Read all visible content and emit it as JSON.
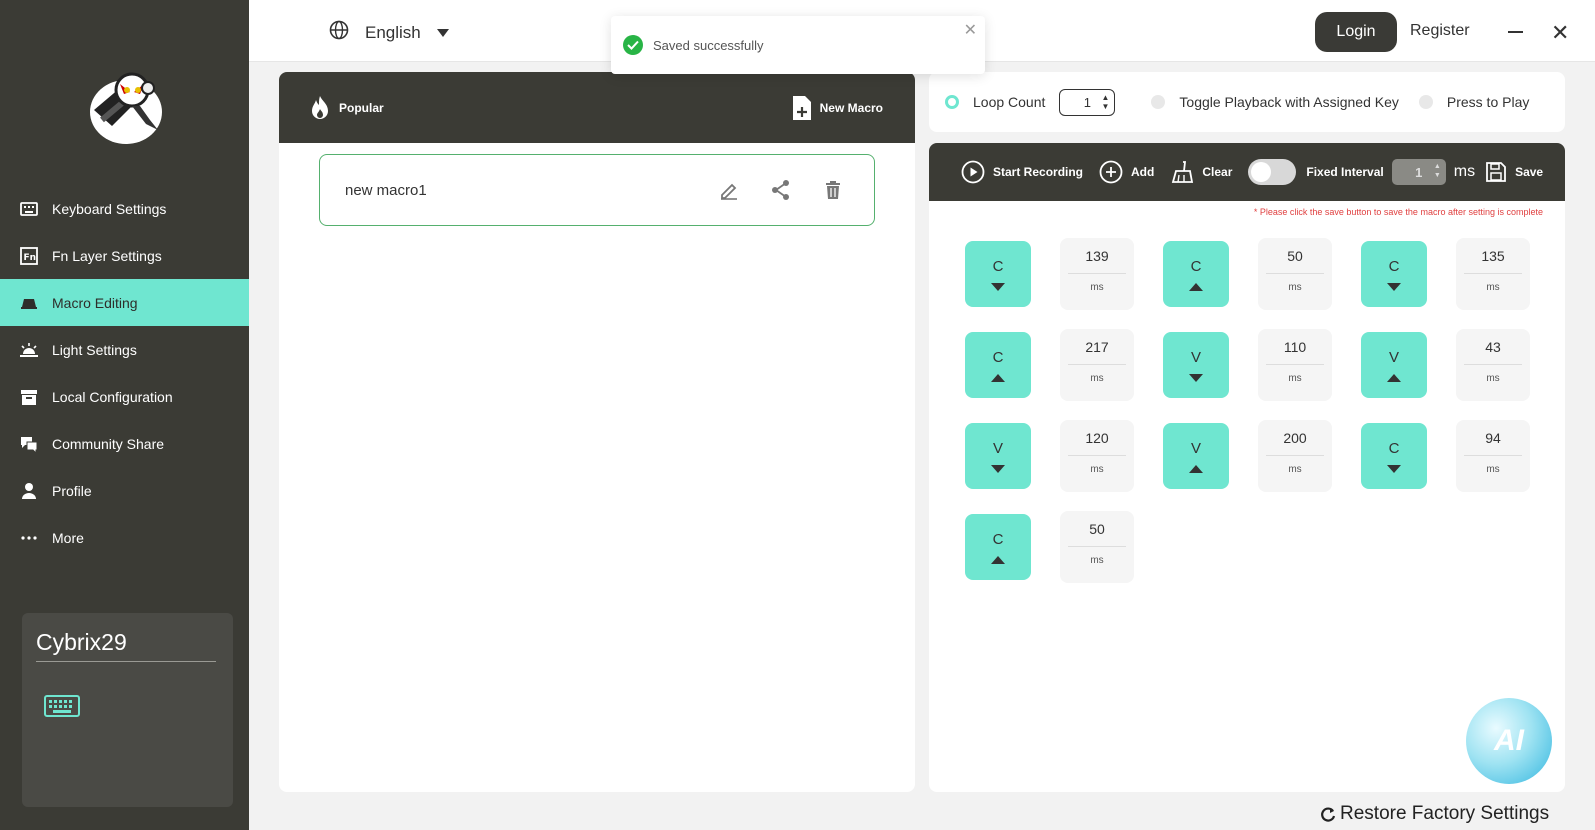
{
  "sidebar": {
    "nav": [
      {
        "label": "Keyboard Settings",
        "icon": "keyboard-icon"
      },
      {
        "label": "Fn Layer Settings",
        "icon": "fn-icon"
      },
      {
        "label": "Macro Editing",
        "icon": "macro-icon"
      },
      {
        "label": "Light Settings",
        "icon": "light-icon"
      },
      {
        "label": "Local Configuration",
        "icon": "archive-icon"
      },
      {
        "label": "Community Share",
        "icon": "chat-icon"
      },
      {
        "label": "Profile",
        "icon": "person-icon"
      },
      {
        "label": "More",
        "icon": "more-icon"
      }
    ],
    "active_index": 2,
    "device_name": "Cybrix29"
  },
  "topbar": {
    "language": "English",
    "login": "Login",
    "register": "Register"
  },
  "toast": {
    "message": "Saved successfully"
  },
  "macros": {
    "popular": "Popular",
    "new_macro": "New Macro",
    "items": [
      "new macro1"
    ]
  },
  "playback": {
    "loop_count_label": "Loop Count",
    "loop_count_value": "1",
    "toggle_label": "Toggle Playback with Assigned Key",
    "press_label": "Press to Play"
  },
  "toolbar": {
    "start_recording": "Start Recording",
    "add": "Add",
    "clear": "Clear",
    "fixed_interval": "Fixed Interval",
    "interval_value": "1",
    "ms": "ms",
    "save": "Save",
    "hint": "* Please click the save button to save the macro after setting is complete"
  },
  "events": [
    {
      "key": "C",
      "dir": "down",
      "delay": "139"
    },
    {
      "key": "C",
      "dir": "up",
      "delay": "50"
    },
    {
      "key": "C",
      "dir": "down",
      "delay": "135"
    },
    {
      "key": "C",
      "dir": "up",
      "delay": "217"
    },
    {
      "key": "V",
      "dir": "down",
      "delay": "110"
    },
    {
      "key": "V",
      "dir": "up",
      "delay": "43"
    },
    {
      "key": "V",
      "dir": "down",
      "delay": "120"
    },
    {
      "key": "V",
      "dir": "up",
      "delay": "200"
    },
    {
      "key": "C",
      "dir": "down",
      "delay": "94"
    },
    {
      "key": "C",
      "dir": "up",
      "delay": "50"
    }
  ],
  "delay_unit": "ms",
  "ai_label": "AI",
  "restore": "Restore Factory Settings",
  "colors": {
    "accent": "#6fe6d0",
    "dark": "#3b3b35",
    "success": "#28b446",
    "warning": "#e04040"
  }
}
